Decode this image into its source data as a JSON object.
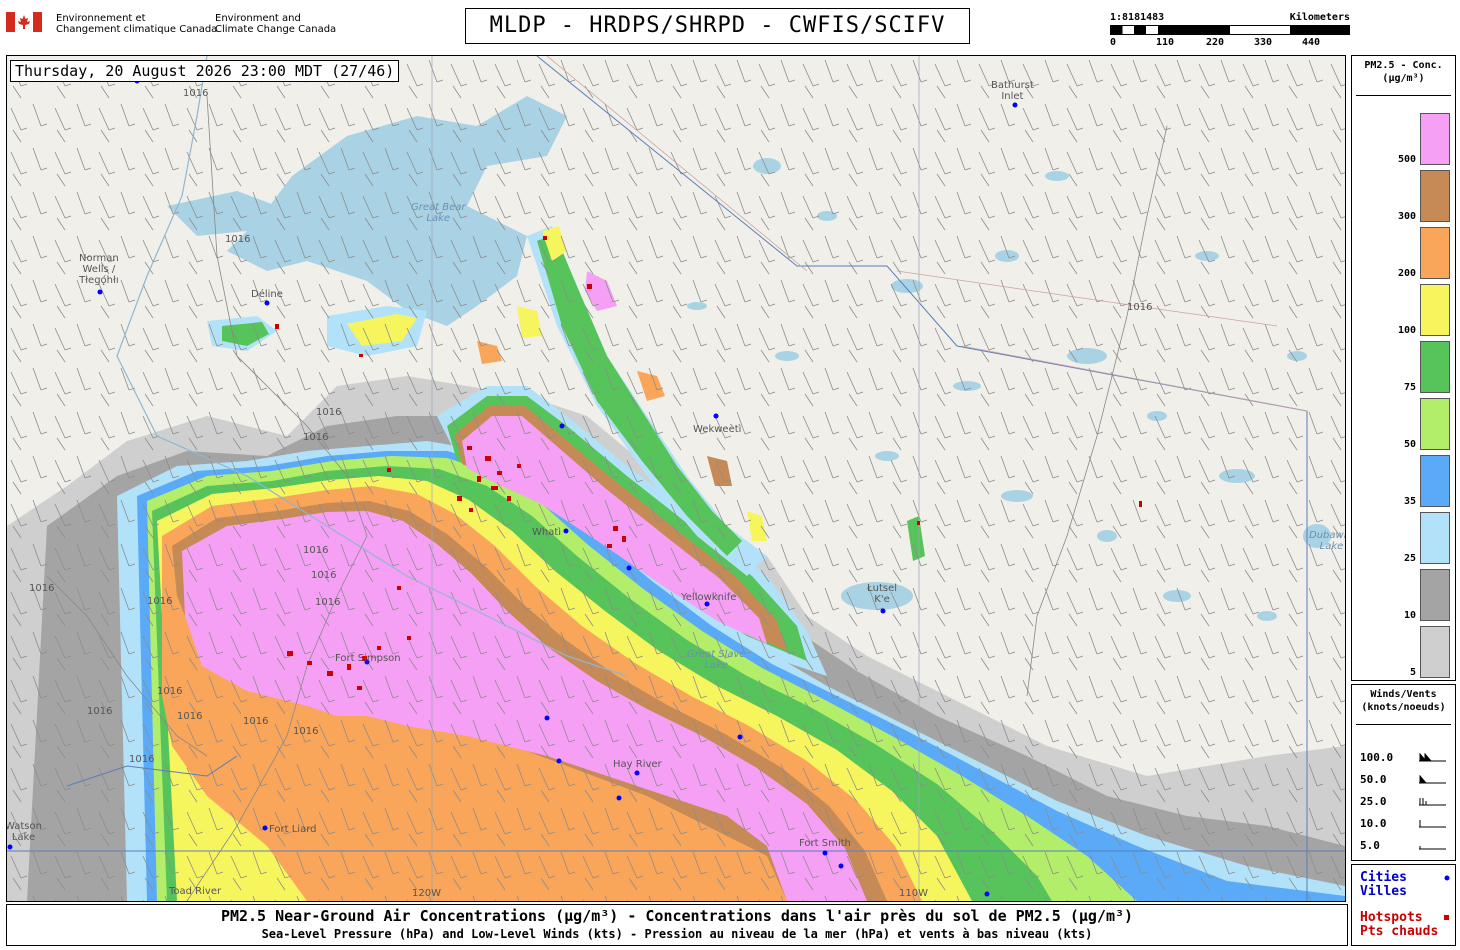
{
  "header": {
    "org_fr": "Environnement et\nChangement climatique Canada",
    "org_en": "Environment and\nClimate Change Canada",
    "title": "MLDP - HRDPS/SHRPD - CWFIS/SCIFV"
  },
  "scale": {
    "ratio": "1:8181483",
    "unit": "Kilometers",
    "ticks": [
      "0",
      "110",
      "220",
      "330",
      "440"
    ]
  },
  "map": {
    "timestamp": "Thursday, 20 August 2026 23:00 MDT (27/46)",
    "places": [
      {
        "name": "Norman\nWells /\nTłegǫ́hłı"
      },
      {
        "name": "Déline"
      },
      {
        "name": "Bathurst\nInlet"
      },
      {
        "name": "Wekweètì"
      },
      {
        "name": "Whatì"
      },
      {
        "name": "Yellowknife"
      },
      {
        "name": "Łutsel\nK'e"
      },
      {
        "name": "Fort Simpson"
      },
      {
        "name": "Hay River"
      },
      {
        "name": "Fort Smith"
      },
      {
        "name": "Fort Liard"
      },
      {
        "name": "Toad River"
      },
      {
        "name": "Watson\nLake"
      }
    ],
    "water": [
      {
        "name": "Great Bear\nLake"
      },
      {
        "name": "Great Slave\nLake"
      },
      {
        "name": "Dubawnt\nLake"
      }
    ],
    "isobar_labels": [
      "1016",
      "1016",
      "1016",
      "1016",
      "1016",
      "1016",
      "1016",
      "1016",
      "1016",
      "1016",
      "1016",
      "1016",
      "1016",
      "1016",
      "1016",
      "1016"
    ],
    "longitudes": [
      "120W",
      "110W"
    ]
  },
  "legend": {
    "title": "PM2.5 - Conc.\n(µg/m³)",
    "levels": [
      {
        "label": "500",
        "color": "#f5a0f5"
      },
      {
        "label": "300",
        "color": "#c68a56"
      },
      {
        "label": "200",
        "color": "#f9a55a"
      },
      {
        "label": "100",
        "color": "#f7f55e"
      },
      {
        "label": "75",
        "color": "#56c45a"
      },
      {
        "label": "50",
        "color": "#b2ee6a"
      },
      {
        "label": "35",
        "color": "#5aaaf7"
      },
      {
        "label": "25",
        "color": "#b2e2f9"
      },
      {
        "label": "10",
        "color": "#a4a4a4"
      },
      {
        "label": "5",
        "color": "#cfcfcf"
      }
    ]
  },
  "winds": {
    "title": "Winds/Vents\n(knots/noeuds)",
    "rows": [
      {
        "label": "100.0"
      },
      {
        "label": "50.0"
      },
      {
        "label": "25.0"
      },
      {
        "label": "10.0"
      },
      {
        "label": "5.0"
      }
    ]
  },
  "keys": {
    "cities": "Cities\nVilles",
    "hotspots": "Hotspots\nPts chauds",
    "city_color": "#0000ff",
    "hotspot_color": "#cc0000"
  },
  "footer": {
    "line1": "PM2.5 Near-Ground Air Concentrations (µg/m³) - Concentrations dans l'air près du sol de PM2.5 (µg/m³)",
    "line2": "Sea-Level Pressure (hPa) and Low-Level Winds (kts) - Pression au niveau de la mer (hPa) et vents à bas niveau (kts)"
  }
}
